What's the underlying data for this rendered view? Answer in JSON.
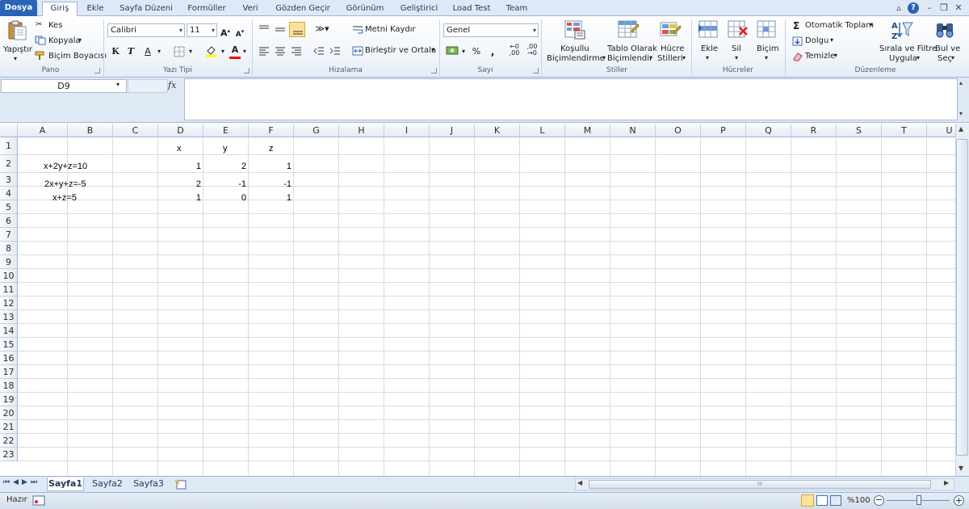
{
  "tabs": {
    "file": "Dosya",
    "home": "Giriş",
    "insert": "Ekle",
    "page_layout": "Sayfa Düzeni",
    "formulas": "Formüller",
    "data": "Veri",
    "review": "Gözden Geçir",
    "view": "Görünüm",
    "developer": "Geliştirici",
    "load_test": "Load Test",
    "team": "Team"
  },
  "clipboard": {
    "paste": "Yapıştır",
    "cut": "Kes",
    "copy": "Kopyala",
    "format_painter": "Biçim Boyacısı",
    "label": "Pano"
  },
  "font": {
    "name": "Calibri",
    "size": "11",
    "bold": "K",
    "italic": "T",
    "underline": "A",
    "label": "Yazı Tipi",
    "fill_color": "#ffff00",
    "font_color": "#ff0000"
  },
  "alignment": {
    "wrap": "Metni Kaydır",
    "merge": "Birleştir ve Ortala",
    "label": "Hizalama"
  },
  "number": {
    "format": "Genel",
    "percent": "%",
    "comma": "000",
    "label": "Sayı"
  },
  "styles": {
    "conditional_1": "Koşullu",
    "conditional_2": "Biçimlendirme",
    "table_1": "Tablo Olarak",
    "table_2": "Biçimlendir",
    "cell_1": "Hücre",
    "cell_2": "Stilleri",
    "label": "Stiller"
  },
  "cells": {
    "insert": "Ekle",
    "delete": "Sil",
    "format": "Biçim",
    "label": "Hücreler"
  },
  "editing": {
    "autosum": "Otomatik Toplam",
    "fill": "Dolgu",
    "clear": "Temizle",
    "sort_1": "Sırala ve Filtre",
    "sort_2": "Uygula",
    "find_1": "Bul ve",
    "find_2": "Seç",
    "label": "Düzenleme"
  },
  "formula_bar": {
    "name_box": "D9",
    "fx": "fx",
    "content": ""
  },
  "columns": [
    "A",
    "B",
    "C",
    "D",
    "E",
    "F",
    "G",
    "H",
    "I",
    "J",
    "K",
    "L",
    "M",
    "N",
    "O",
    "P",
    "Q",
    "R",
    "S",
    "T",
    "U"
  ],
  "rows": [
    "1",
    "2",
    "3",
    "4",
    "5",
    "6",
    "7",
    "8",
    "9",
    "10",
    "11",
    "12",
    "13",
    "14",
    "15",
    "16",
    "17",
    "18",
    "19",
    "20",
    "21",
    "22",
    "23"
  ],
  "cells_data": {
    "D1": "x",
    "E1": "y",
    "F1": "z",
    "A2": "x+2y+z=10",
    "D2": "1",
    "E2": "2",
    "F2": "1",
    "A3": "2x+y+z=-5",
    "D3": "2",
    "E3": "-1",
    "F3": "-1",
    "A4": "x+z=5",
    "D4": "1",
    "E4": "0",
    "F4": "1"
  },
  "sheets": {
    "sheet1": "Sayfa1",
    "sheet2": "Sayfa2",
    "sheet3": "Sayfa3",
    "active": "Sayfa1"
  },
  "status": {
    "mode": "Hazır",
    "zoom": "%100"
  },
  "hscroll_mark": "III",
  "colors": {
    "file_tab": "#2a63b8",
    "ribbon_border": "#9eb6d4",
    "gridline": "#dadcdd"
  }
}
